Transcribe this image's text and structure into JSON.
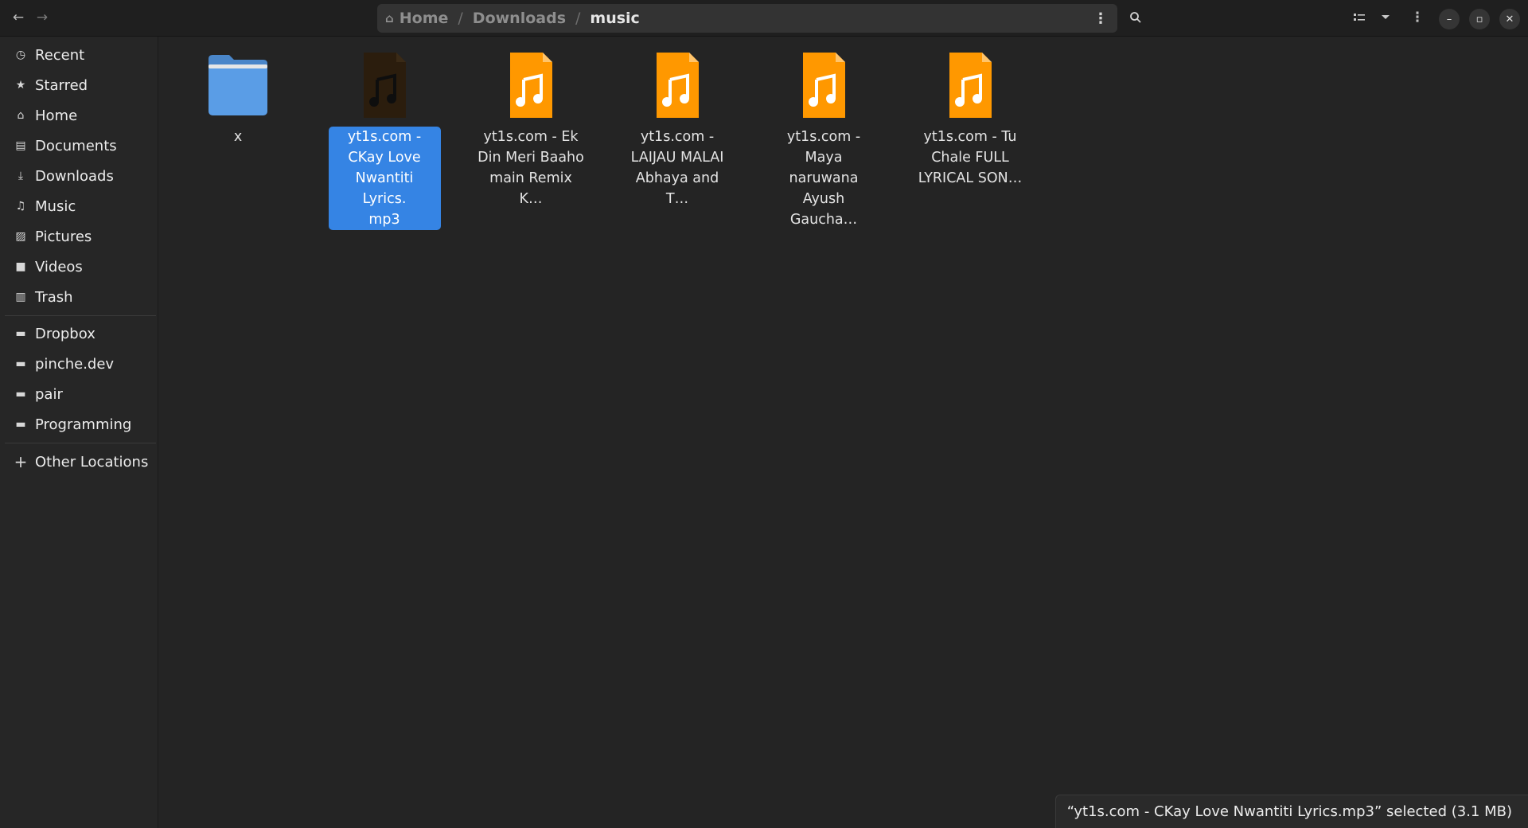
{
  "headerbar": {
    "back_icon": "arrow-left-icon",
    "forward_icon": "arrow-right-icon",
    "path": {
      "home": "Home",
      "downloads": "Downloads",
      "current": "music",
      "separator": "/"
    },
    "menu_icon": "vertical-dots-icon",
    "search_icon": "search-icon",
    "view_icon": "list-view-icon",
    "sort_icon": "chevron-down-icon",
    "main_menu_icon": "kebab-menu-icon",
    "minimize_glyph": "–",
    "maximize_glyph": "▫",
    "close_glyph": "✕"
  },
  "sidebar": {
    "places": [
      {
        "label": "Recent",
        "icon": "clock-icon",
        "glyph": "◷"
      },
      {
        "label": "Starred",
        "icon": "star-icon",
        "glyph": "★"
      },
      {
        "label": "Home",
        "icon": "home-icon",
        "glyph": "⌂"
      },
      {
        "label": "Documents",
        "icon": "document-icon",
        "glyph": "▤"
      },
      {
        "label": "Downloads",
        "icon": "download-icon",
        "glyph": "⤓"
      },
      {
        "label": "Music",
        "icon": "music-icon",
        "glyph": "♫"
      },
      {
        "label": "Pictures",
        "icon": "picture-icon",
        "glyph": "▨"
      },
      {
        "label": "Videos",
        "icon": "video-camera-icon",
        "glyph": "■"
      },
      {
        "label": "Trash",
        "icon": "trash-icon",
        "glyph": "▥"
      }
    ],
    "bookmarks": [
      {
        "label": "Dropbox",
        "icon": "folder-icon",
        "glyph": "▬"
      },
      {
        "label": "pinche.dev",
        "icon": "folder-icon",
        "glyph": "▬"
      },
      {
        "label": "pair",
        "icon": "folder-icon",
        "glyph": "▬"
      },
      {
        "label": "Programming",
        "icon": "folder-icon",
        "glyph": "▬"
      }
    ],
    "other": {
      "label": "Other Locations",
      "icon": "plus-icon",
      "glyph": "+"
    }
  },
  "files": [
    {
      "name": "x",
      "kind": "folder",
      "icon": "folder-icon",
      "selected": false
    },
    {
      "name": "yt1s.com - CKay  Love Nwantiti Lyrics.mp3",
      "display_lines": [
        "yt1s.com -",
        "CKay  Love",
        "Nwantiti Lyrics.",
        "mp3"
      ],
      "kind": "audio",
      "icon": "audio-file-icon",
      "selected": true
    },
    {
      "display_lines": [
        "yt1s.com - Ek",
        "Din  Meri Baaho",
        "main  Remix K…"
      ],
      "kind": "audio",
      "icon": "audio-file-icon",
      "selected": false
    },
    {
      "display_lines": [
        "yt1s.com -",
        "LAIJAU MALAI",
        "Abhaya and T…"
      ],
      "kind": "audio",
      "icon": "audio-file-icon",
      "selected": false
    },
    {
      "display_lines": [
        "yt1s.com - Maya",
        "naruwana",
        "Ayush Gaucha…"
      ],
      "kind": "audio",
      "icon": "audio-file-icon",
      "selected": false
    },
    {
      "display_lines": [
        "yt1s.com - Tu",
        "Chale FULL",
        "LYRICAL SON…"
      ],
      "kind": "audio",
      "icon": "audio-file-icon",
      "selected": false
    }
  ],
  "status": {
    "text": "“yt1s.com - CKay  Love Nwantiti Lyrics.mp3” selected (3.1 MB)"
  },
  "colors": {
    "accent": "#3584e4",
    "folder": "#5a9de6",
    "audio_file": "#ff9800",
    "background": "#242424"
  }
}
